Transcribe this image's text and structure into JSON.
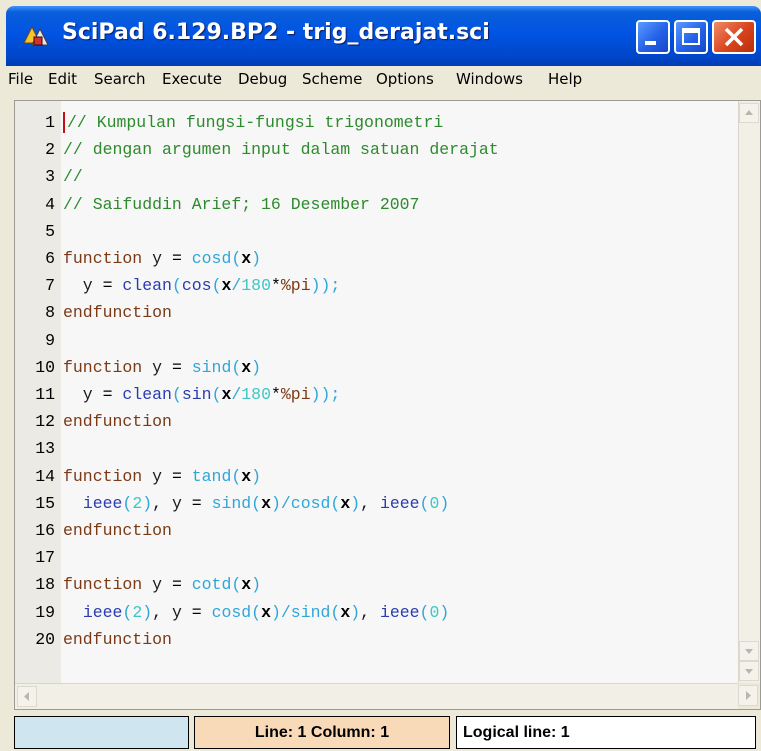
{
  "window": {
    "title": "SciPad 6.129.BP2 - trig_derajat.sci"
  },
  "menu": {
    "items": [
      "File",
      "Edit",
      "Search",
      "Execute",
      "Debug",
      "Scheme",
      "Options",
      "Windows",
      "Help"
    ]
  },
  "editor": {
    "line_numbers": [
      "1",
      "2",
      "3",
      "4",
      "5",
      "6",
      "7",
      "8",
      "9",
      "10",
      "11",
      "12",
      "13",
      "14",
      "15",
      "16",
      "17",
      "18",
      "19",
      "20"
    ],
    "lines": [
      [
        {
          "t": "// Kumpulan fungsi-fungsi trigonometri",
          "c": "comment"
        }
      ],
      [
        {
          "t": "// dengan argumen input dalam satuan derajat",
          "c": "comment"
        }
      ],
      [
        {
          "t": "//",
          "c": "comment"
        }
      ],
      [
        {
          "t": "// Saifuddin Arief; 16 Desember 2007",
          "c": "comment"
        }
      ],
      [],
      [
        {
          "t": "function",
          "c": "kw"
        },
        {
          "t": " y ",
          "c": "plain"
        },
        {
          "t": "=",
          "c": "op"
        },
        {
          "t": " ",
          "c": "plain"
        },
        {
          "t": "cosd",
          "c": "fn"
        },
        {
          "t": "(",
          "c": "fn"
        },
        {
          "t": "x",
          "c": "var"
        },
        {
          "t": ")",
          "c": "fn"
        }
      ],
      [
        {
          "t": "  y ",
          "c": "plain"
        },
        {
          "t": "=",
          "c": "op"
        },
        {
          "t": " ",
          "c": "plain"
        },
        {
          "t": "clean",
          "c": "builtin"
        },
        {
          "t": "(",
          "c": "fn"
        },
        {
          "t": "cos",
          "c": "builtin"
        },
        {
          "t": "(",
          "c": "fn"
        },
        {
          "t": "x",
          "c": "var"
        },
        {
          "t": "/",
          "c": "fn"
        },
        {
          "t": "180",
          "c": "num"
        },
        {
          "t": "*",
          "c": "op"
        },
        {
          "t": "%pi",
          "c": "const"
        },
        {
          "t": "));",
          "c": "fn"
        }
      ],
      [
        {
          "t": "endfunction",
          "c": "kw"
        }
      ],
      [],
      [
        {
          "t": "function",
          "c": "kw"
        },
        {
          "t": " y ",
          "c": "plain"
        },
        {
          "t": "=",
          "c": "op"
        },
        {
          "t": " ",
          "c": "plain"
        },
        {
          "t": "sind",
          "c": "fn"
        },
        {
          "t": "(",
          "c": "fn"
        },
        {
          "t": "x",
          "c": "var"
        },
        {
          "t": ")",
          "c": "fn"
        }
      ],
      [
        {
          "t": "  y ",
          "c": "plain"
        },
        {
          "t": "=",
          "c": "op"
        },
        {
          "t": " ",
          "c": "plain"
        },
        {
          "t": "clean",
          "c": "builtin"
        },
        {
          "t": "(",
          "c": "fn"
        },
        {
          "t": "sin",
          "c": "builtin"
        },
        {
          "t": "(",
          "c": "fn"
        },
        {
          "t": "x",
          "c": "var"
        },
        {
          "t": "/",
          "c": "fn"
        },
        {
          "t": "180",
          "c": "num"
        },
        {
          "t": "*",
          "c": "op"
        },
        {
          "t": "%pi",
          "c": "const"
        },
        {
          "t": "));",
          "c": "fn"
        }
      ],
      [
        {
          "t": "endfunction",
          "c": "kw"
        }
      ],
      [],
      [
        {
          "t": "function",
          "c": "kw"
        },
        {
          "t": " y ",
          "c": "plain"
        },
        {
          "t": "=",
          "c": "op"
        },
        {
          "t": " ",
          "c": "plain"
        },
        {
          "t": "tand",
          "c": "fn"
        },
        {
          "t": "(",
          "c": "fn"
        },
        {
          "t": "x",
          "c": "var"
        },
        {
          "t": ")",
          "c": "fn"
        }
      ],
      [
        {
          "t": "  ",
          "c": "plain"
        },
        {
          "t": "ieee",
          "c": "builtin"
        },
        {
          "t": "(",
          "c": "fn"
        },
        {
          "t": "2",
          "c": "num"
        },
        {
          "t": ")",
          "c": "fn"
        },
        {
          "t": ", y ",
          "c": "plain"
        },
        {
          "t": "=",
          "c": "op"
        },
        {
          "t": " ",
          "c": "plain"
        },
        {
          "t": "sind",
          "c": "fn"
        },
        {
          "t": "(",
          "c": "fn"
        },
        {
          "t": "x",
          "c": "var"
        },
        {
          "t": ")/",
          "c": "fn"
        },
        {
          "t": "cosd",
          "c": "fn"
        },
        {
          "t": "(",
          "c": "fn"
        },
        {
          "t": "x",
          "c": "var"
        },
        {
          "t": ")",
          "c": "fn"
        },
        {
          "t": ", ",
          "c": "plain"
        },
        {
          "t": "ieee",
          "c": "builtin"
        },
        {
          "t": "(",
          "c": "fn"
        },
        {
          "t": "0",
          "c": "num"
        },
        {
          "t": ")",
          "c": "fn"
        }
      ],
      [
        {
          "t": "endfunction",
          "c": "kw"
        }
      ],
      [],
      [
        {
          "t": "function",
          "c": "kw"
        },
        {
          "t": " y ",
          "c": "plain"
        },
        {
          "t": "=",
          "c": "op"
        },
        {
          "t": " ",
          "c": "plain"
        },
        {
          "t": "cotd",
          "c": "fn"
        },
        {
          "t": "(",
          "c": "fn"
        },
        {
          "t": "x",
          "c": "var"
        },
        {
          "t": ")",
          "c": "fn"
        }
      ],
      [
        {
          "t": "  ",
          "c": "plain"
        },
        {
          "t": "ieee",
          "c": "builtin"
        },
        {
          "t": "(",
          "c": "fn"
        },
        {
          "t": "2",
          "c": "num"
        },
        {
          "t": ")",
          "c": "fn"
        },
        {
          "t": ", y ",
          "c": "plain"
        },
        {
          "t": "=",
          "c": "op"
        },
        {
          "t": " ",
          "c": "plain"
        },
        {
          "t": "cosd",
          "c": "fn"
        },
        {
          "t": "(",
          "c": "fn"
        },
        {
          "t": "x",
          "c": "var"
        },
        {
          "t": ")/",
          "c": "fn"
        },
        {
          "t": "sind",
          "c": "fn"
        },
        {
          "t": "(",
          "c": "fn"
        },
        {
          "t": "x",
          "c": "var"
        },
        {
          "t": ")",
          "c": "fn"
        },
        {
          "t": ", ",
          "c": "plain"
        },
        {
          "t": "ieee",
          "c": "builtin"
        },
        {
          "t": "(",
          "c": "fn"
        },
        {
          "t": "0",
          "c": "num"
        },
        {
          "t": ")",
          "c": "fn"
        }
      ],
      [
        {
          "t": "endfunction",
          "c": "kw"
        }
      ]
    ]
  },
  "status": {
    "position": "Line: 1 Column: 1",
    "logical": "Logical line: 1"
  },
  "colors": {
    "titlebar": "#0054e3",
    "comment": "#2d8a2d",
    "keyword": "#7a3a16",
    "function_name": "#2fa6d8",
    "builtin": "#2a3cb0",
    "number": "#3ec6c6",
    "status_cell_1": "#cfe6f0",
    "status_cell_2": "#f8d9b8",
    "cursor": "#c0101a"
  },
  "icons": {
    "app": "scipad-app-icon",
    "minimize": "minimize-icon",
    "maximize": "maximize-icon",
    "close": "close-icon"
  }
}
